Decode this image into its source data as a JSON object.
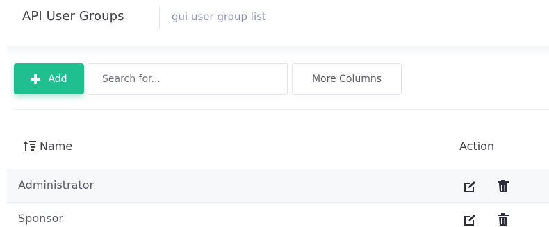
{
  "header": {
    "title": "API User Groups",
    "breadcrumb": "gui user group list"
  },
  "toolbar": {
    "add_label": "Add",
    "search_placeholder": "Search for...",
    "search_value": "",
    "more_columns_label": "More Columns"
  },
  "table": {
    "columns": [
      "Name",
      "Action"
    ],
    "rows": [
      {
        "name": "Administrator"
      },
      {
        "name": "Sponsor"
      }
    ]
  },
  "icons": {
    "add": "plus-icon",
    "sort": "sort-icon",
    "edit": "edit-icon",
    "delete": "trash-icon"
  },
  "colors": {
    "accent": "#1fbf8f",
    "breadcrumb": "#8b8fb3",
    "text": "#3f4047",
    "row_alt": "#f7f8fa"
  }
}
